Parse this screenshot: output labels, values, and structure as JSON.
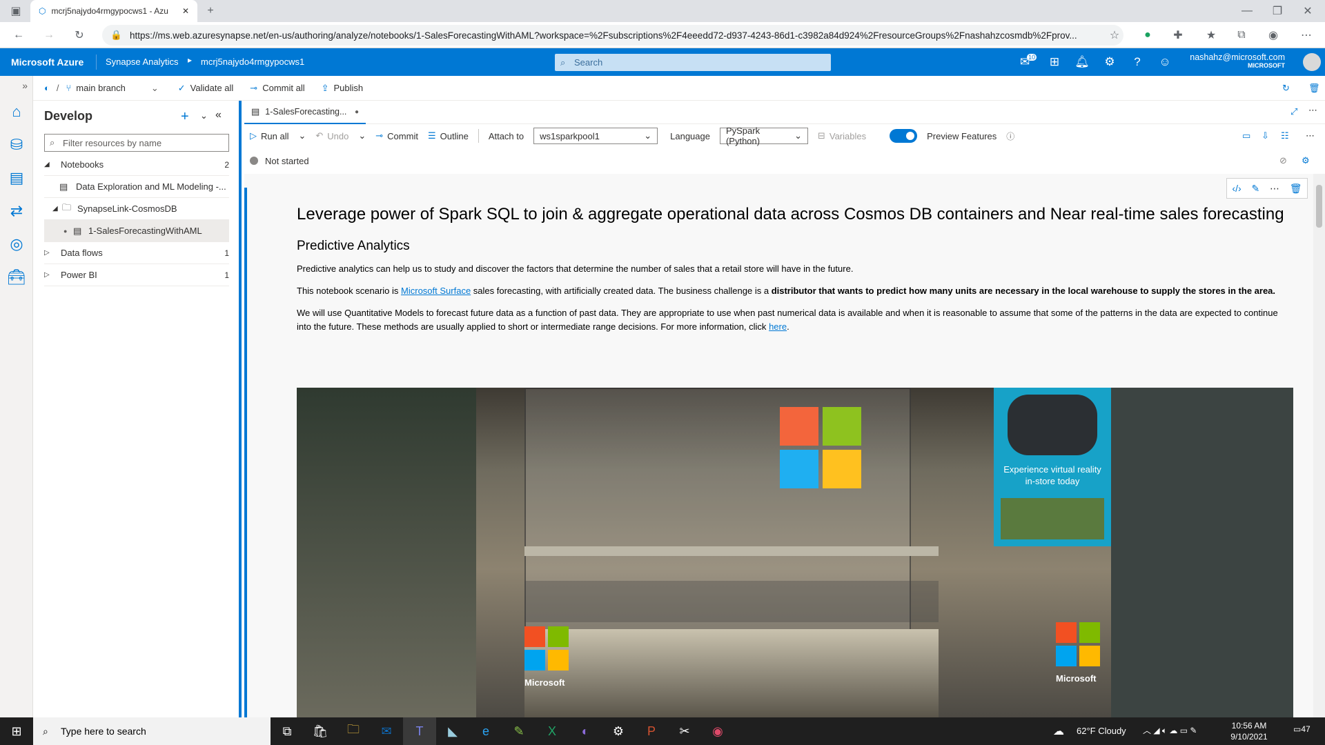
{
  "browser": {
    "tab_title": "mcrj5najydo4rmgypocws1 - Azu",
    "url": "https://ms.web.azuresynapse.net/en-us/authoring/analyze/notebooks/1-SalesForecastingWithAML?workspace=%2Fsubscriptions%2F4eeedd72-d937-4243-86d1-c3982a84d924%2FresourceGroups%2Fnashahzcosmdb%2Fprov..."
  },
  "azure_header": {
    "brand": "Microsoft Azure",
    "service": "Synapse Analytics",
    "workspace": "mcrj5najydo4rmgypocws1",
    "search_placeholder": "Search",
    "notification_badge": "10",
    "user_email": "nashahz@microsoft.com",
    "user_org": "MICROSOFT"
  },
  "git_bar": {
    "branch": "main branch",
    "validate_all": "Validate all",
    "commit_all": "Commit all",
    "publish": "Publish"
  },
  "develop": {
    "title": "Develop",
    "filter_placeholder": "Filter resources by name",
    "sections": [
      {
        "label": "Notebooks",
        "count": "2"
      },
      {
        "label": "Data flows",
        "count": "1"
      },
      {
        "label": "Power BI",
        "count": "1"
      }
    ],
    "items": {
      "notebook1": "Data Exploration and ML Modeling -...",
      "folder": "SynapseLink-CosmosDB",
      "notebook2": "1-SalesForecastingWithAML"
    }
  },
  "notebook_tab": {
    "label": "1-SalesForecasting..."
  },
  "toolbar": {
    "run_all": "Run all",
    "undo": "Undo",
    "commit": "Commit",
    "outline": "Outline",
    "attach_to_label": "Attach to",
    "attach_to_value": "ws1sparkpool1",
    "language_label": "Language",
    "language_value": "PySpark (Python)",
    "variables": "Variables",
    "preview_features": "Preview Features"
  },
  "status": {
    "text": "Not started"
  },
  "cell": {
    "title": "Leverage power of Spark SQL to join & aggregate operational data across Cosmos DB containers and Near real-time sales forecasting",
    "subtitle": "Predictive Analytics",
    "para1": "Predictive analytics can help us to study and discover the factors that determine the number of sales that a retail store will have in the future.",
    "para2_prefix": "This notebook scenario is ",
    "para2_link": "Microsoft Surface",
    "para2_mid": " sales forecasting, with artificially created data. The business challenge is a ",
    "para2_bold": "distributor that wants to predict how many units are necessary in the local warehouse to supply the stores in the area.",
    "para3": "We will use Quantitative Models to forecast future data as a function of past data. They are appropriate to use when past numerical data is available and when it is reasonable to assume that some of the patterns in the data are expected to continue into the future. These methods are usually applied to short or intermediate range decisions. For more information, click ",
    "para3_link": "here",
    "image_store_sign_left": "Microsoft",
    "image_store_sign_right": "Microsoft",
    "image_vr_banner": "Experience virtual reality in-store today"
  },
  "taskbar": {
    "search_placeholder": "Type here to search",
    "weather": "62°F  Cloudy",
    "time": "10:56 AM",
    "date": "9/10/2021",
    "notification_count": "47"
  }
}
